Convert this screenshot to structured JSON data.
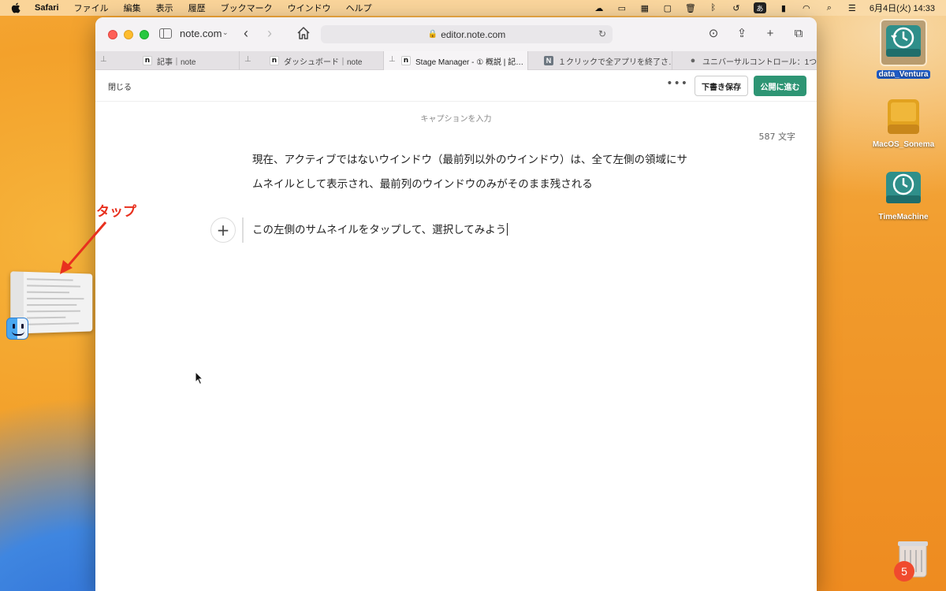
{
  "menubar": {
    "app": "Safari",
    "items": [
      "ファイル",
      "編集",
      "表示",
      "履歴",
      "ブックマーク",
      "ウインドウ",
      "ヘルプ"
    ],
    "ime": "あ",
    "clock": "6月4日(火)  14:33"
  },
  "browser": {
    "tab_group": "note.com",
    "url": "editor.note.com",
    "tabs": [
      {
        "label": "記事｜note",
        "favicon": "n",
        "pinned": true
      },
      {
        "label": "ダッシュボード｜note",
        "favicon": "n",
        "pinned": true
      },
      {
        "label": "Stage Manager - ① 概説 | 記…",
        "favicon": "n",
        "pinned": true
      },
      {
        "label": "１クリックで全アプリを終了さ…",
        "favicon": "N",
        "pinned": false
      },
      {
        "label": "ユニバーサルコントロール：1つ…",
        "favicon": "apple-icon",
        "pinned": false
      }
    ]
  },
  "editor": {
    "close_label": "閉じる",
    "more_label": "•••",
    "draft_label": "下書き保存",
    "publish_label": "公開に進む",
    "caption_placeholder": "キャプションを入力",
    "char_count": "587 文字",
    "paragraph1": "現在、アクティブではないウインドウ（最前列以外のウインドウ）は、全て左側の領域にサムネイルとして表示され、最前列のウインドウのみがそのまま残される",
    "paragraph2": "この左側のサムネイルをタップして、選択してみよう",
    "plus_label": "+"
  },
  "annotation": {
    "label": "タップ",
    "color": "#e8301e"
  },
  "desktop": {
    "icons": [
      {
        "label": "data_Ventura",
        "type": "timemachine-drive-icon",
        "selected": true
      },
      {
        "label": "MacOS_Sonema",
        "type": "external-drive-icon",
        "selected": false
      },
      {
        "label": "TimeMachine",
        "type": "timemachine-drive-icon",
        "selected": false
      }
    ],
    "trash_badge": "5"
  },
  "colors": {
    "publish": "#2e9574",
    "annotation": "#e8301e"
  }
}
